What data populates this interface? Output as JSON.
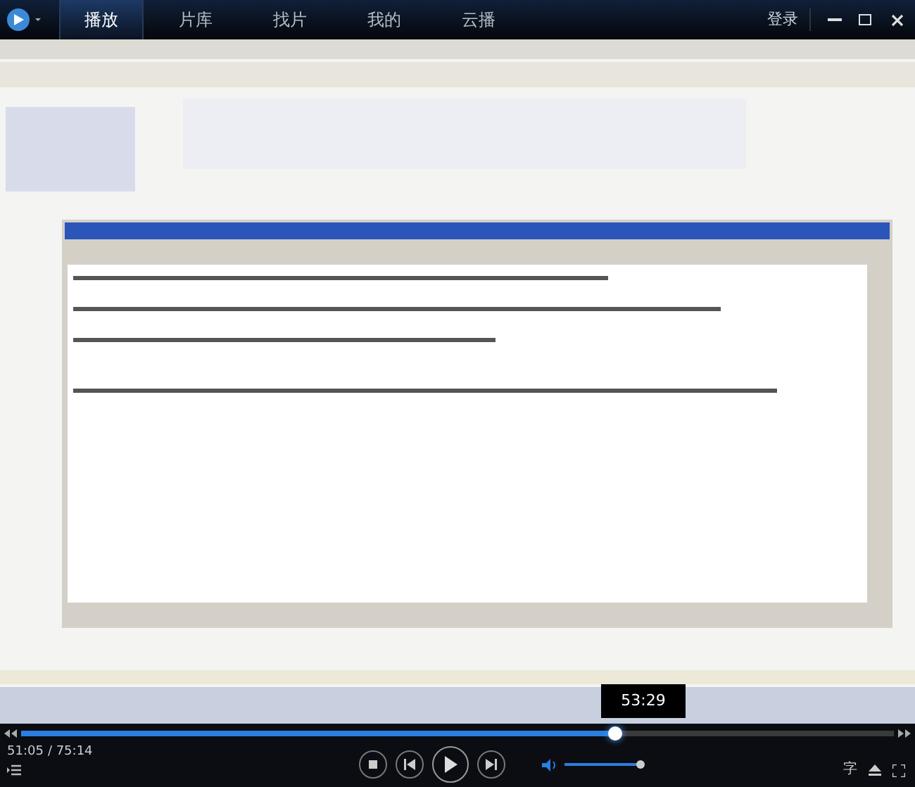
{
  "nav": {
    "tabs": [
      {
        "label": "播放",
        "selected": true
      },
      {
        "label": "片库",
        "selected": false
      },
      {
        "label": "找片",
        "selected": false
      },
      {
        "label": "我的",
        "selected": false
      },
      {
        "label": "云播",
        "selected": false
      }
    ],
    "login": "登录"
  },
  "seek": {
    "tooltip": "53:29",
    "level": 0.68
  },
  "time": {
    "elapsed": "51:05",
    "total": "/ 75:14"
  },
  "volume": {
    "level": 1
  },
  "subtitle": "字"
}
